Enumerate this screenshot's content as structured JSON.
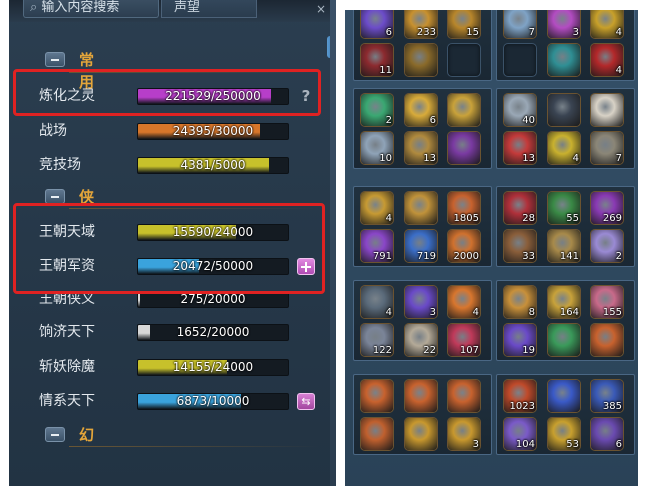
{
  "left_panel": {
    "search": {
      "placeholder": "输入内容搜索"
    },
    "tab_label": "声望",
    "sections": [
      {
        "label": "常用",
        "rows": [
          {
            "name": "炼化之灵",
            "value": "221529/250000",
            "fill": 0.886,
            "color": "#b73ec9",
            "button": "help"
          },
          {
            "name": "战场",
            "value": "24395/30000",
            "fill": 0.813,
            "color": "#d7762a",
            "button": null
          },
          {
            "name": "竞技场",
            "value": "4381/5000",
            "fill": 0.876,
            "color": "#c7c12b",
            "button": null
          }
        ]
      },
      {
        "label": "侠",
        "rows": [
          {
            "name": "王朝天域",
            "value": "15590/24000",
            "fill": 0.65,
            "color": "#c7c12b",
            "button": null
          },
          {
            "name": "王朝军资",
            "value": "20472/50000",
            "fill": 0.409,
            "color": "#3aa3dc",
            "button": "plus"
          },
          {
            "name": "王朝侠义",
            "value": "275/20000",
            "fill": 0.014,
            "color": "#d8d8d8",
            "button": null
          },
          {
            "name": "饷济天下",
            "value": "1652/20000",
            "fill": 0.083,
            "color": "#d8d8d8",
            "button": null
          },
          {
            "name": "斩妖除魔",
            "value": "14155/24000",
            "fill": 0.59,
            "color": "#c7c12b",
            "button": null
          },
          {
            "name": "情系天下",
            "value": "6873/10000",
            "fill": 0.687,
            "color": "#3aa3dc",
            "button": "swap"
          }
        ]
      },
      {
        "label": "幻",
        "rows": []
      }
    ],
    "help_glyph": "?",
    "swap_glyph": "⇆",
    "close_glyph": "×"
  },
  "inventory": {
    "groups": [
      {
        "slots": [
          {
            "count": "6",
            "icon": "purple-orb-icon",
            "color": "#6c4cc9"
          },
          {
            "count": "233",
            "icon": "gold-coin-icon",
            "color": "#c8912f"
          },
          {
            "count": "15",
            "icon": "gold-gem-icon",
            "color": "#b8862b"
          },
          {
            "count": "11",
            "icon": "red-mask-icon",
            "color": "#8c2a2f"
          },
          {
            "count": "",
            "icon": "gold-ring-icon",
            "color": "#8a6a2a"
          },
          {
            "count": "",
            "icon": "empty-slot-icon",
            "color": ""
          }
        ]
      },
      {
        "slots": [
          {
            "count": "7",
            "icon": "blue-crystal-icon",
            "color": "#7fa3c6"
          },
          {
            "count": "3",
            "icon": "purple-sword-icon",
            "color": "#b34cc2"
          },
          {
            "count": "4",
            "icon": "gold-box-icon",
            "color": "#c8a02a"
          },
          {
            "count": "",
            "icon": "empty-slot-icon",
            "color": ""
          },
          {
            "count": "",
            "icon": "teal-rune-icon",
            "color": "#2f8f94"
          },
          {
            "count": "4",
            "icon": "red-swirl-icon",
            "color": "#b3282a"
          }
        ]
      },
      {
        "slots": [
          {
            "count": "2",
            "icon": "jade-icon",
            "color": "#3aa872"
          },
          {
            "count": "6",
            "icon": "gold-ingot-icon",
            "color": "#d8ab3a"
          },
          {
            "count": "",
            "icon": "gold-pouch-icon",
            "color": "#c9a23a"
          },
          {
            "count": "10",
            "icon": "silver-orb-icon",
            "color": "#8fa3b8"
          },
          {
            "count": "13",
            "icon": "gold-mound-icon",
            "color": "#b08a3e"
          },
          {
            "count": "",
            "icon": "purple-rose-icon",
            "color": "#7a3aa2"
          }
        ]
      },
      {
        "slots": [
          {
            "count": "40",
            "icon": "feather-icon",
            "color": "#9aa8b6"
          },
          {
            "count": "",
            "icon": "dark-figure-icon",
            "color": "#3a4452"
          },
          {
            "count": "",
            "icon": "mahjong-icon",
            "color": "#d8d2c6"
          },
          {
            "count": "13",
            "icon": "red-flower-icon",
            "color": "#c43a3a"
          },
          {
            "count": "4",
            "icon": "gold-nugget-icon",
            "color": "#c9b12e"
          },
          {
            "count": "7",
            "icon": "stone-icon",
            "color": "#8b8677"
          }
        ]
      },
      {
        "slots": [
          {
            "count": "4",
            "icon": "crown-icon",
            "color": "#c79a33"
          },
          {
            "count": "",
            "icon": "crown-icon",
            "color": "#c0923a"
          },
          {
            "count": "1805",
            "icon": "fire-icon",
            "color": "#c8622e"
          },
          {
            "count": "791",
            "icon": "purple-star-icon",
            "color": "#8a46c8"
          },
          {
            "count": "719",
            "icon": "blue-star-icon",
            "color": "#3b6ec8"
          },
          {
            "count": "2000",
            "icon": "flame-burst-icon",
            "color": "#d0712e"
          }
        ]
      },
      {
        "slots": [
          {
            "count": "28",
            "icon": "red-shield-icon",
            "color": "#b0303a"
          },
          {
            "count": "55",
            "icon": "green-shield-icon",
            "color": "#3a8a46"
          },
          {
            "count": "269",
            "icon": "purple-shield-icon",
            "color": "#8a3ab4"
          },
          {
            "count": "33",
            "icon": "brown-tower-icon",
            "color": "#8a5e3a"
          },
          {
            "count": "141",
            "icon": "scroll-icon",
            "color": "#a88a4a"
          },
          {
            "count": "2",
            "icon": "lavender-card-icon",
            "color": "#9a8ad4"
          }
        ]
      },
      {
        "slots": [
          {
            "count": "4",
            "icon": "silver-blade-icon",
            "color": "#5a6a7a"
          },
          {
            "count": "3",
            "icon": "purple-bolt-icon",
            "color": "#6a4ac8"
          },
          {
            "count": "4",
            "icon": "orange-blast-icon",
            "color": "#d8762e"
          },
          {
            "count": "122",
            "icon": "silver-crown-icon",
            "color": "#7a8498"
          },
          {
            "count": "22",
            "icon": "silver-tablet-icon",
            "color": "#b4aa98"
          },
          {
            "count": "107",
            "icon": "red-orb-icon",
            "color": "#c03a5a"
          }
        ]
      },
      {
        "slots": [
          {
            "count": "8",
            "icon": "golden-blade-icon",
            "color": "#c8903a"
          },
          {
            "count": "164",
            "icon": "gold-book-icon",
            "color": "#c8a23a"
          },
          {
            "count": "155",
            "icon": "pink-item-icon",
            "color": "#c86a8a"
          },
          {
            "count": "19",
            "icon": "green-swirl-icon",
            "color": "#6a4ac8"
          },
          {
            "count": "",
            "icon": "green-snake-icon",
            "color": "#3a9a5a"
          },
          {
            "count": "",
            "icon": "orange-rune-icon",
            "color": "#c8622e"
          }
        ]
      },
      {
        "slots": [
          {
            "count": "",
            "icon": "orange-rune-icon",
            "color": "#c8622e"
          },
          {
            "count": "",
            "icon": "orange-rune-icon",
            "color": "#c8622e"
          },
          {
            "count": "",
            "icon": "orange-rune-icon",
            "color": "#c8622e"
          },
          {
            "count": "",
            "icon": "orange-rune-icon",
            "color": "#c0602e"
          },
          {
            "count": "",
            "icon": "gold-seal-icon",
            "color": "#c8982e"
          },
          {
            "count": "3",
            "icon": "gold-seal-icon",
            "color": "#c8982e"
          }
        ]
      },
      {
        "slots": [
          {
            "count": "1023",
            "icon": "red-gold-box-icon",
            "color": "#c04a2a"
          },
          {
            "count": "",
            "icon": "star-sparkle-icon",
            "color": "#3a5ac8"
          },
          {
            "count": "385",
            "icon": "blue-star-icon",
            "color": "#3a5ab8"
          },
          {
            "count": "104",
            "icon": "crystal-cluster-icon",
            "color": "#7a5ac8"
          },
          {
            "count": "53",
            "icon": "gold-pouch-icon",
            "color": "#c8a02e"
          },
          {
            "count": "6",
            "icon": "gem-cluster-icon",
            "color": "#6a4ab0"
          }
        ]
      }
    ]
  }
}
